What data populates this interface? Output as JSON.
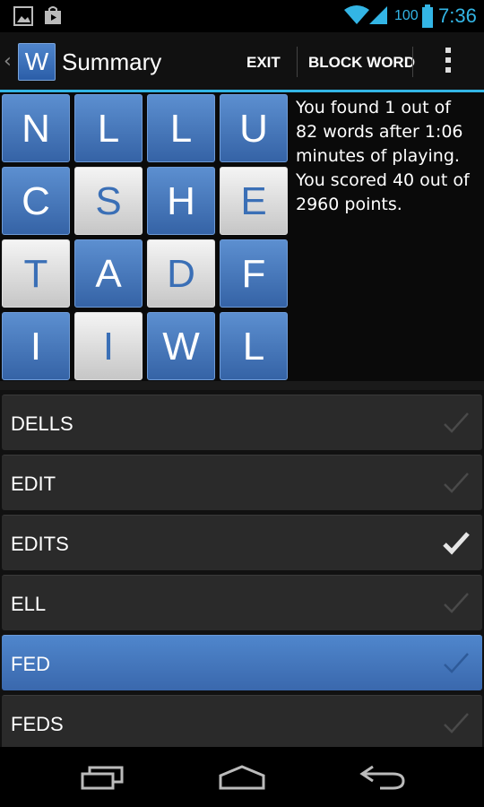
{
  "status_bar": {
    "battery_percent": "100",
    "time": "7:36"
  },
  "action_bar": {
    "app_icon_letter": "W",
    "title": "Summary",
    "exit_label": "EXIT",
    "block_word_label": "BLOCK WORD"
  },
  "board": {
    "tiles": [
      {
        "letter": "N",
        "style": "blue"
      },
      {
        "letter": "L",
        "style": "blue"
      },
      {
        "letter": "L",
        "style": "blue"
      },
      {
        "letter": "U",
        "style": "blue"
      },
      {
        "letter": "C",
        "style": "blue"
      },
      {
        "letter": "S",
        "style": "white"
      },
      {
        "letter": "H",
        "style": "blue"
      },
      {
        "letter": "E",
        "style": "white"
      },
      {
        "letter": "T",
        "style": "white"
      },
      {
        "letter": "A",
        "style": "blue"
      },
      {
        "letter": "D",
        "style": "white"
      },
      {
        "letter": "F",
        "style": "blue"
      },
      {
        "letter": "I",
        "style": "blue"
      },
      {
        "letter": "I",
        "style": "white"
      },
      {
        "letter": "W",
        "style": "blue"
      },
      {
        "letter": "L",
        "style": "blue"
      }
    ]
  },
  "summary": {
    "line1": "You found 1 out of",
    "line2": "82 words after 1:06",
    "line3": "minutes of playing.",
    "line4": "You scored 40 out of",
    "line5": "2960 points."
  },
  "word_list": [
    {
      "word": "DELLS",
      "found": false,
      "selected": false
    },
    {
      "word": "EDIT",
      "found": false,
      "selected": false
    },
    {
      "word": "EDITS",
      "found": true,
      "selected": false
    },
    {
      "word": "ELL",
      "found": false,
      "selected": false
    },
    {
      "word": "FED",
      "found": false,
      "selected": true
    },
    {
      "word": "FEDS",
      "found": false,
      "selected": false
    }
  ],
  "colors": {
    "accent": "#33b5e5",
    "tile_blue": "#3f70b5",
    "tile_white": "#e6e6e6",
    "selected_row": "#4576bc"
  }
}
